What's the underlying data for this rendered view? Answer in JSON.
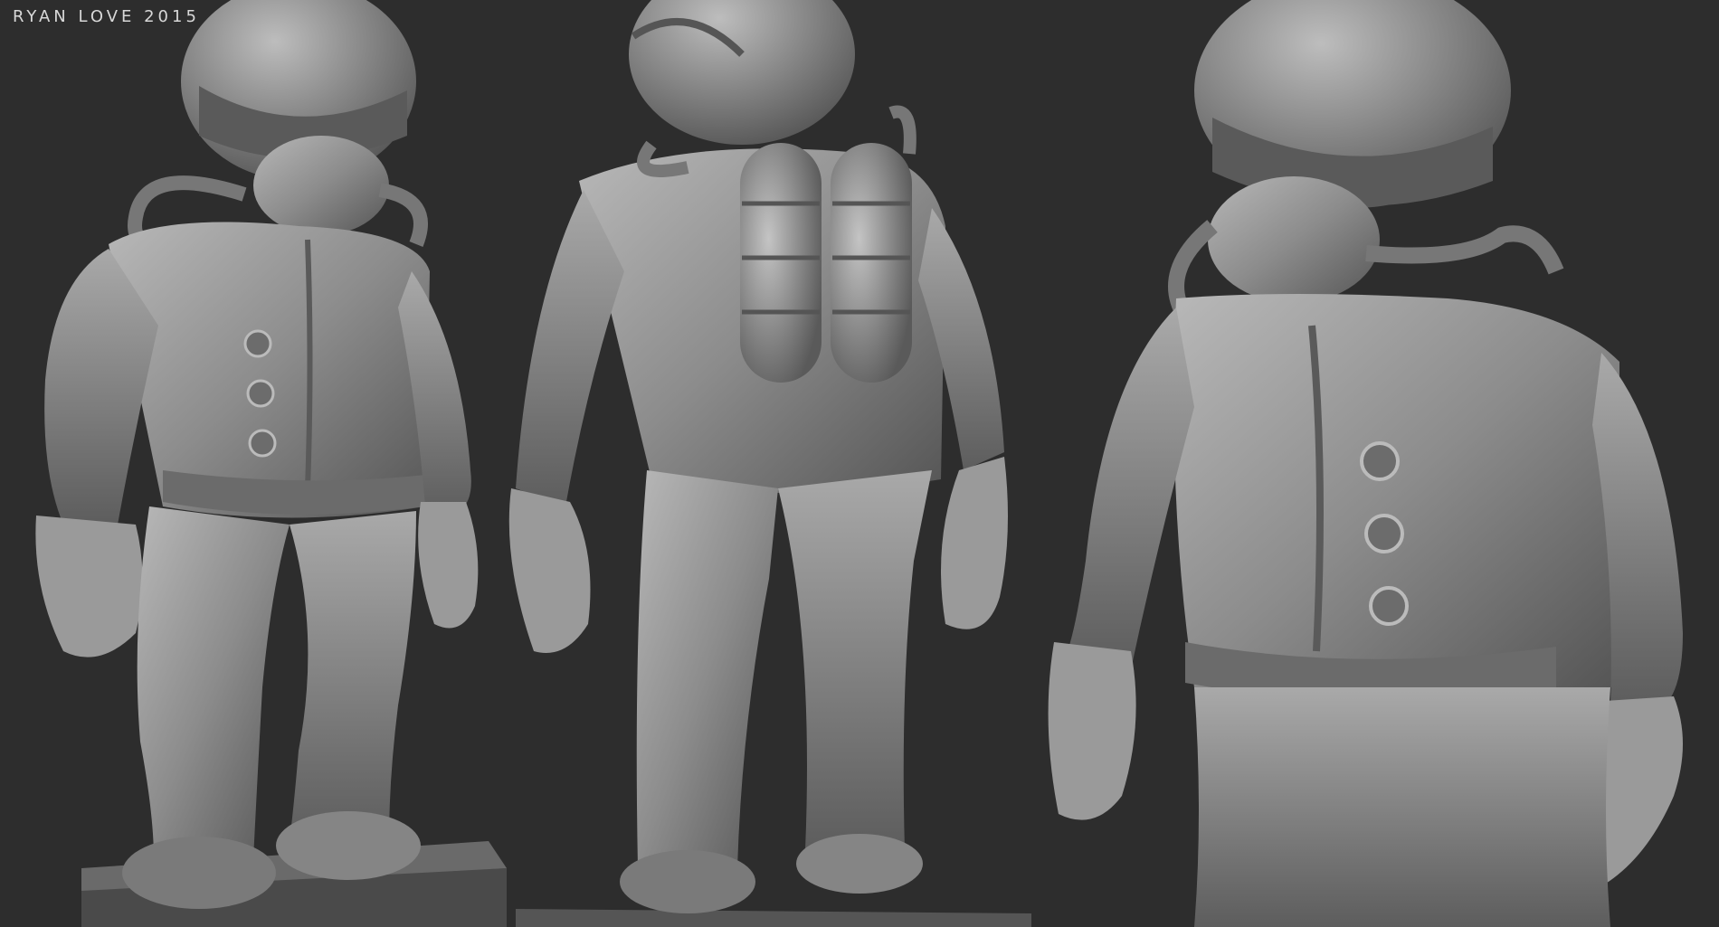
{
  "credit": {
    "text": "RYAN LOVE 2015"
  },
  "views": [
    {
      "name": "front-three-quarter-view"
    },
    {
      "name": "back-three-quarter-view"
    },
    {
      "name": "front-close-up-view"
    }
  ],
  "colors": {
    "background": "#2d2d2d",
    "clay": "#8a8a8a",
    "clay_light": "#b5b5b5",
    "clay_dark": "#4a4a4a"
  }
}
